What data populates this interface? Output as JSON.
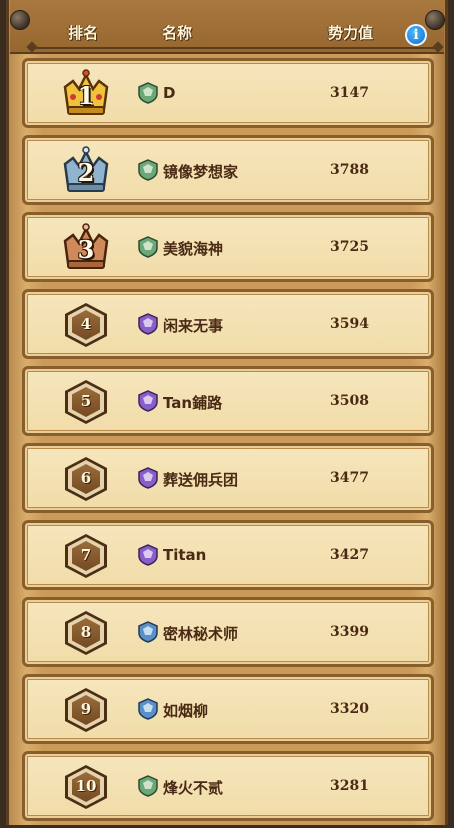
{
  "header": {
    "rank_label": "排名",
    "name_label": "名称",
    "power_label": "势力值",
    "info_label": "i"
  },
  "rows": [
    {
      "rank": "1",
      "name": "D",
      "power": "3147"
    },
    {
      "rank": "2",
      "name": "镜像梦想家",
      "power": "3788"
    },
    {
      "rank": "3",
      "name": "美貌海神",
      "power": "3725"
    },
    {
      "rank": "4",
      "name": "闲来无事",
      "power": "3594"
    },
    {
      "rank": "5",
      "name": "Tan鋪路",
      "power": "3508"
    },
    {
      "rank": "6",
      "name": "葬送佣兵团",
      "power": "3477"
    },
    {
      "rank": "7",
      "name": "Titan",
      "power": "3427"
    },
    {
      "rank": "8",
      "name": "密林秘术师",
      "power": "3399"
    },
    {
      "rank": "9",
      "name": "如烟柳",
      "power": "3320"
    },
    {
      "rank": "10",
      "name": "烽火不贰",
      "power": "3281"
    }
  ],
  "colors": {
    "gold_crown": "#f0c43a",
    "silver_crown": "#8fb4cf",
    "bronze_crown": "#d08a5a",
    "emblem_green": "#5fa070",
    "emblem_purple": "#8a5ec8",
    "emblem_blue": "#5a8fc8"
  }
}
